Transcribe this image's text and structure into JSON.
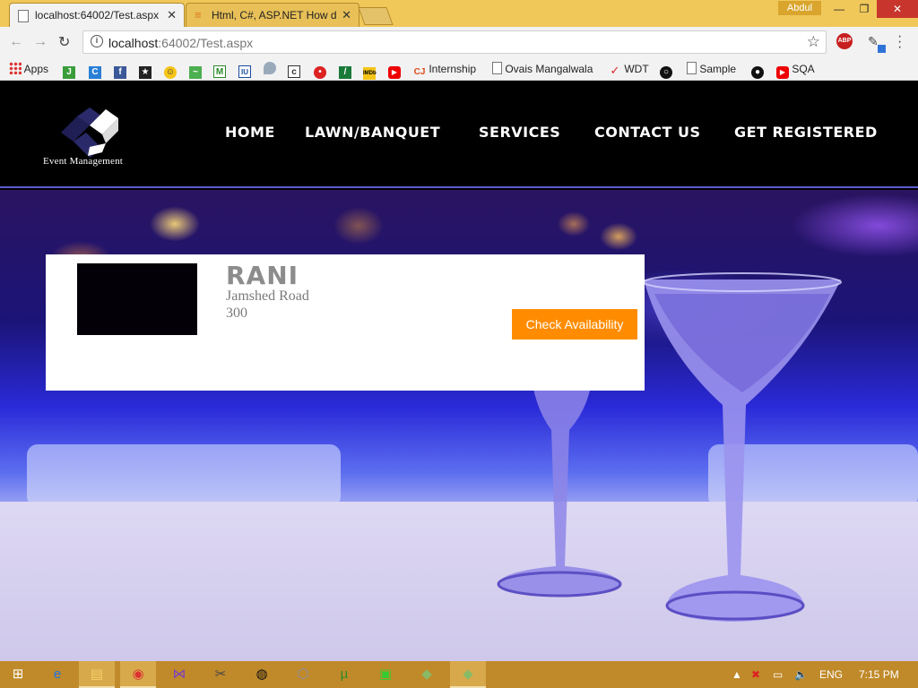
{
  "browser": {
    "tabs": [
      {
        "title": "localhost:64002/Test.aspx",
        "active": true
      },
      {
        "title": "Html, C#, ASP.NET How d",
        "active": false
      }
    ],
    "user": "Abdul",
    "url_host": "localhost",
    "url_path": ":64002/Test.aspx",
    "bookmarks": [
      {
        "label": "Apps",
        "icon": "apps-grid-icon"
      },
      {
        "label": "",
        "icon": "jn-icon"
      },
      {
        "label": "",
        "icon": "c-icon"
      },
      {
        "label": "",
        "icon": "facebook-icon"
      },
      {
        "label": "",
        "icon": "site-icon"
      },
      {
        "label": "",
        "icon": "smiley-icon"
      },
      {
        "label": "",
        "icon": "link-icon"
      },
      {
        "label": "",
        "icon": "m-icon"
      },
      {
        "label": "",
        "icon": "iu-icon"
      },
      {
        "label": "",
        "icon": "drop-icon"
      },
      {
        "label": "",
        "icon": "c-dot-icon"
      },
      {
        "label": "",
        "icon": "ladybug-icon"
      },
      {
        "label": "",
        "icon": "leaf-icon"
      },
      {
        "label": "",
        "icon": "imdb-icon"
      },
      {
        "label": "",
        "icon": "youtube-icon"
      },
      {
        "label": "Internship",
        "icon": "cj-icon"
      },
      {
        "label": "Ovais Mangalwala",
        "icon": "page-icon"
      },
      {
        "label": "WDT",
        "icon": "check-icon"
      },
      {
        "label": "",
        "icon": "chat-icon"
      },
      {
        "label": "Sample",
        "icon": "page-icon"
      },
      {
        "label": "",
        "icon": "github-icon"
      },
      {
        "label": "SQA",
        "icon": "youtube-icon"
      }
    ]
  },
  "site": {
    "logo_text": "Event Management",
    "nav": [
      "HOME",
      "LAWN/BANQUET",
      "SERVICES",
      "CONTACT US",
      "GET REGISTERED"
    ]
  },
  "card": {
    "title": "RANI",
    "address": "Jamshed Road",
    "price": "300",
    "button": "Check Availability"
  },
  "taskbar": {
    "lang": "ENG",
    "time": "7:15 PM"
  }
}
